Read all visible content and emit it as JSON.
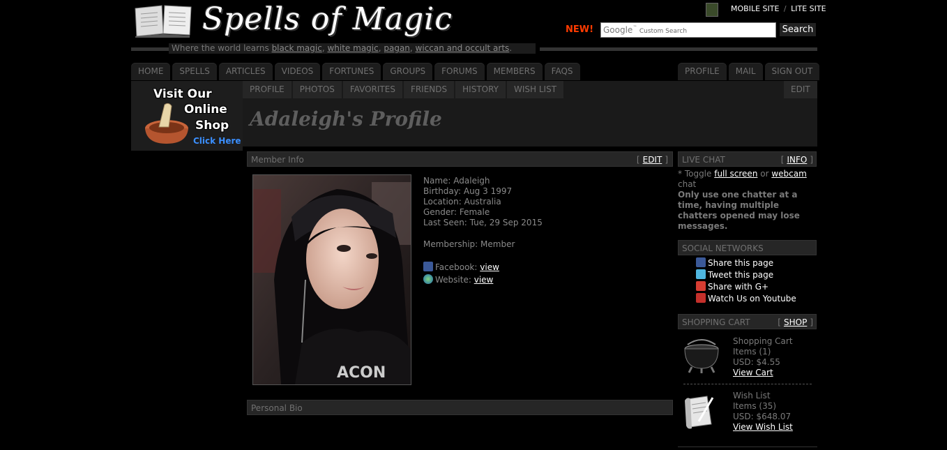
{
  "header": {
    "logo_text": "Spells of Magic",
    "mobile_site": "MOBILE SITE",
    "separator": "/",
    "lite_site": "LITE SITE",
    "new_badge": "NEW!",
    "search_brand": "Google",
    "search_placeholder": "Custom Search",
    "search_button": "Search",
    "tagline_prefix": "Where the world learns ",
    "tagline_links": [
      "black magic",
      "white magic",
      "pagan",
      "wiccan and occult arts"
    ],
    "tagline_commas": [
      ", ",
      ", ",
      ", ",
      "."
    ]
  },
  "nav": {
    "main_tabs": [
      "HOME",
      "SPELLS",
      "ARTICLES",
      "VIDEOS",
      "FORTUNES",
      "GROUPS",
      "FORUMS",
      "MEMBERS",
      "FAQS"
    ],
    "right_tabs": [
      "PROFILE",
      "MAIL",
      "SIGN OUT"
    ],
    "sub_tabs": [
      "PROFILE",
      "PHOTOS",
      "FAVORITES",
      "FRIENDS",
      "HISTORY",
      "WISH LIST"
    ],
    "sub_edit": "EDIT"
  },
  "shop_ad": {
    "line1": "Visit Our",
    "line2": "Online",
    "line3": "Shop",
    "click": "Click Here"
  },
  "profile": {
    "title": "Adaleigh's Profile",
    "member_info_header": "Member Info",
    "edit_label": "EDIT",
    "name": "Name: Adaleigh",
    "birthday": "Birthday: Aug 3 1997",
    "location": "Location: Australia",
    "gender": "Gender: Female",
    "last_seen": "Last Seen: Tue, 29 Sep 2015",
    "membership": "Membership: Member",
    "facebook_label": "Facebook:",
    "website_label": "Website:",
    "view_label": "view",
    "bio_header": "Personal Bio"
  },
  "live_chat": {
    "header": "LIVE CHAT",
    "info": "INFO",
    "toggle_prefix": "* Toggle ",
    "full_screen": "full screen",
    "or": " or ",
    "webcam": "webcam",
    "chat": "chat",
    "warning": "Only use one chatter at a time, having multiple chatters opened may lose messages."
  },
  "social": {
    "header": "SOCIAL NETWORKS",
    "items": [
      "Share this page",
      "Tweet this page",
      "Share with G+",
      "Watch Us on Youtube"
    ]
  },
  "cart": {
    "header": "SHOPPING CART",
    "shop": "SHOP",
    "cart_title": "Shopping Cart",
    "cart_items": "Items (1)",
    "cart_usd": "USD: $4.55",
    "view_cart": "View Cart",
    "wish_title": "Wish List",
    "wish_items": "Items (35)",
    "wish_usd": "USD: $648.07",
    "view_wish": "View Wish List"
  },
  "colors": {
    "background": "#000000",
    "panel": "#262626",
    "new_badge": "#ff3b00",
    "click_here": "#3b8fff"
  }
}
